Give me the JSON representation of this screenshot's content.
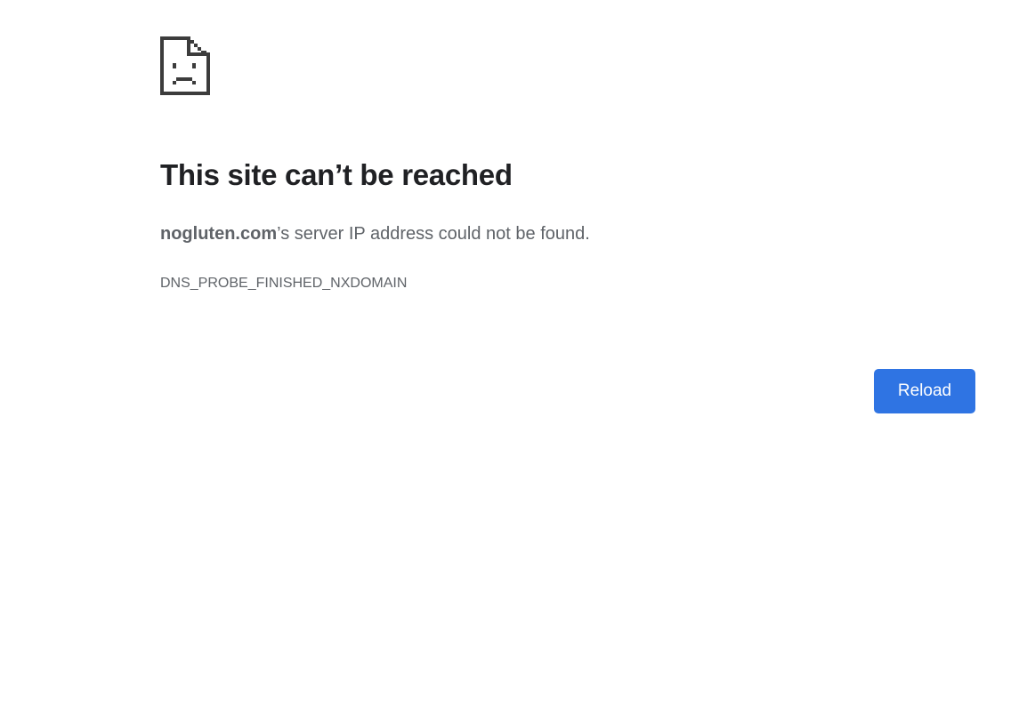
{
  "error_page": {
    "icon": "sad-page-icon",
    "headline": "This site can’t be reached",
    "message": {
      "domain": "nogluten.com",
      "suffix": "’s server IP address could not be found."
    },
    "error_code": "DNS_PROBE_FINISHED_NXDOMAIN",
    "reload_label": "Reload"
  },
  "colors": {
    "text_primary": "#202124",
    "text_secondary": "#5f6368",
    "button_bg": "#2f74e3",
    "icon": "#3c3c3c"
  }
}
